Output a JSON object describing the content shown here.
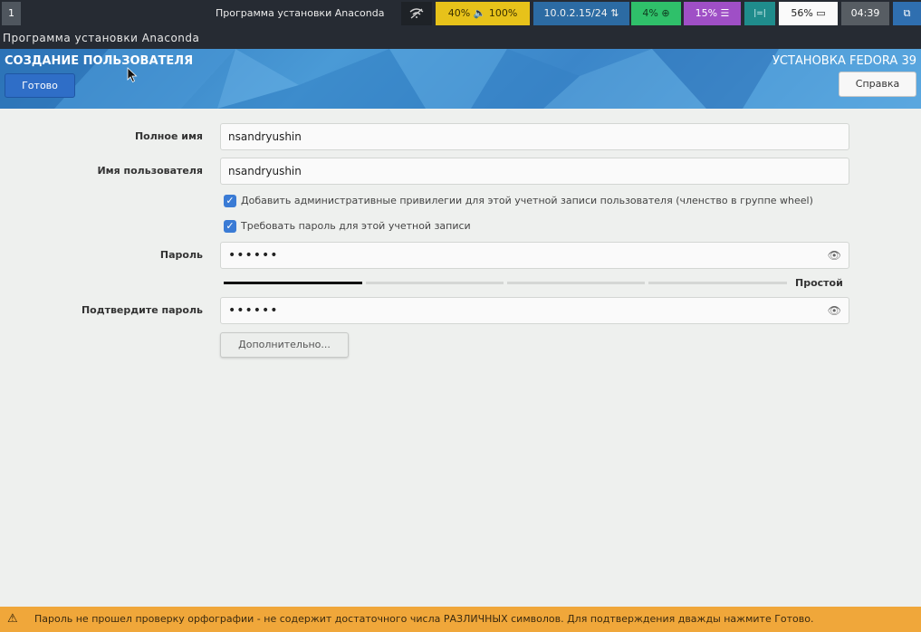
{
  "topbar": {
    "workspace": "1",
    "window_title": "Программа установки Anaconda",
    "volume": "40% 🔈 100%",
    "network": "10.0.2.15/24 ⇅",
    "cpu": "4% ⊕",
    "memory": "15% ☰",
    "teal_item": "|=|",
    "battery": "56% ▭",
    "clock": "04:39",
    "tray_icon": "⧉"
  },
  "app_title": "Программа установки Anaconda",
  "header": {
    "spoke_title": "СОЗДАНИЕ ПОЛЬЗОВАТЕЛЯ",
    "product_title": "УСТАНОВКА FEDORA 39",
    "done_label": "Готово",
    "help_label": "Справка"
  },
  "form": {
    "fullname_label": "Полное имя",
    "fullname_value": "nsandryushin",
    "username_label": "Имя пользователя",
    "username_value": "nsandryushin",
    "admin_checkbox_label": "Добавить административные привилегии для этой учетной записи пользователя (членство в группе wheel)",
    "password_required_label": "Требовать пароль для этой учетной записи",
    "password_label": "Пароль",
    "password_value": "••••••",
    "strength_label": "Простой",
    "strength_level": 0.25,
    "confirm_label": "Подтвердите пароль",
    "confirm_value": "••••••",
    "advanced_label": "Дополнительно..."
  },
  "warning": {
    "text": "Пароль не прошел проверку орфографии - не содержит достаточного числа РАЗЛИЧНЫХ символов. Для подтверждения дважды нажмите Готово."
  },
  "colors": {
    "accent": "#2f6ec7",
    "warning": "#f0a73a",
    "header": "#3b86c9"
  }
}
